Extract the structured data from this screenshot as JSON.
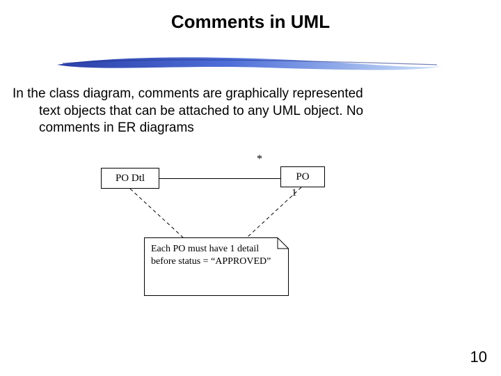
{
  "title": "Comments in UML",
  "body_line1": "In the class diagram, comments are graphically represented",
  "body_line2": "text objects that can be attached to any UML object. No",
  "body_line3": "comments in ER diagrams",
  "uml": {
    "left_class": "PO Dtl",
    "right_class": "PO",
    "mult_top": "*",
    "mult_bottom": "1",
    "note_text": "Each PO must have 1 detail before status = “APPROVED”"
  },
  "page_number": "10",
  "colors": {
    "brush_dark": "#2b3fa8",
    "brush_mid": "#4f6fd8",
    "brush_light": "#a6c6f2"
  }
}
